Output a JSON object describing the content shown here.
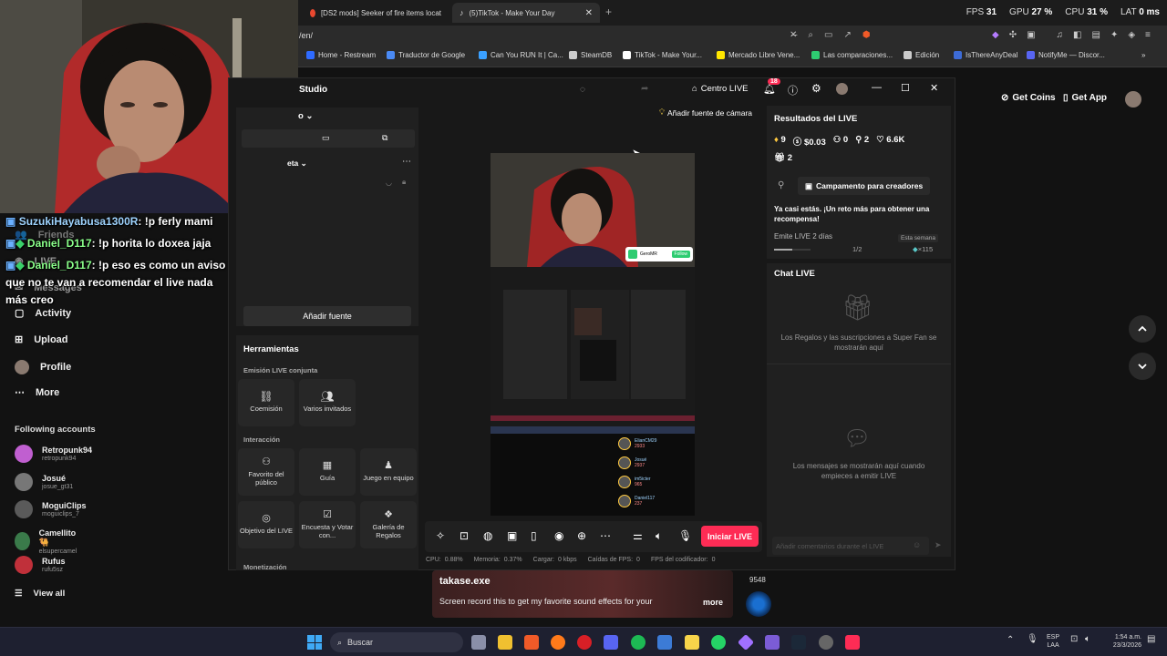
{
  "browser": {
    "tabs": [
      {
        "label": "[DS2 mods] Seeker of fire items locat",
        "active": false
      },
      {
        "label": "(5)TikTok - Make Your Day",
        "active": true
      }
    ],
    "url": "/en/",
    "perf": {
      "fps_label": "FPS",
      "fps": "31",
      "gpu_label": "GPU",
      "gpu": "27 %",
      "cpu_label": "CPU",
      "cpu": "31 %",
      "lat_label": "LAT",
      "lat": "0 ms"
    },
    "bookmarks": [
      {
        "label": "Home - Restream",
        "color": "#2f6bff"
      },
      {
        "label": "Traductor de Google",
        "color": "#4a8af4"
      },
      {
        "label": "Can You RUN It | Ca...",
        "color": "#3aa0ff"
      },
      {
        "label": "SteamDB",
        "color": "#cccccc"
      },
      {
        "label": "TikTok - Make Your...",
        "color": "#ffffff"
      },
      {
        "label": "Mercado Libre Vene...",
        "color": "#ffe600"
      },
      {
        "label": "Las comparaciones...",
        "color": "#2ecc71"
      },
      {
        "label": "Edición",
        "color": "#cccccc"
      },
      {
        "label": "IsThereAnyDeal",
        "color": "#3d6bd6"
      },
      {
        "label": "NotifyMe — Discor...",
        "color": "#5865f2"
      }
    ]
  },
  "chat_overlay": [
    {
      "user": "SuzukiHayabusa1300R",
      "msg": ": !p ferly mami"
    },
    {
      "user": "Daniel_D117",
      "msg": ": !p horita lo doxea jaja"
    },
    {
      "user": "Daniel_D117",
      "msg": ": !p eso es como un aviso que no te van a recomendar el live nada más creo"
    }
  ],
  "sidebar": {
    "items": [
      {
        "label": "Friends"
      },
      {
        "label": "LIVE"
      },
      {
        "label": "Messages"
      },
      {
        "label": "Activity"
      },
      {
        "label": "Upload"
      },
      {
        "label": "Profile"
      },
      {
        "label": "More"
      }
    ],
    "following_title": "Following accounts",
    "accounts": [
      {
        "name": "Retropunk94",
        "handle": "retropunk94",
        "color": "#c05fd0"
      },
      {
        "name": "Josué",
        "handle": "josue_gt31",
        "color": "#777777"
      },
      {
        "name": "MoguiClips",
        "handle": "moguiclips_7",
        "color": "#5a5a5a"
      },
      {
        "name": "Camellito 🐫",
        "handle": "elsupercamel",
        "color": "#3a7a4a"
      },
      {
        "name": "Rufus",
        "handle": "rufu5sz",
        "color": "#c0303a"
      }
    ],
    "view_all": "View all"
  },
  "header_right": {
    "get_coins": "Get Coins",
    "get_app": "Get App"
  },
  "studio": {
    "title": "Studio",
    "scene_dropdown": "o",
    "folder_dropdown": "eta",
    "centro_live": "Centro LIVE",
    "notif_count": "18",
    "camera_hint": "Añadir fuente de cámara",
    "add_source": "Añadir fuente",
    "tools_title": "Herramientas",
    "joint_title": "Emisión LIVE conjunta",
    "joint_tools": [
      "Coemisión",
      "Varios invitados"
    ],
    "interaction_title": "Interacción",
    "interaction_tools": [
      "Favorito del público",
      "Guía",
      "Juego en equipo",
      "Objetivo del LIVE",
      "Encuesta y Votar con...",
      "Galería de Regalos"
    ],
    "monetization_title": "Monetización",
    "go_live": "Iniciar LIVE",
    "stats": [
      {
        "label": "CPU:",
        "value": "0.88%"
      },
      {
        "label": "Memoria:",
        "value": "0.37%"
      },
      {
        "label": "Cargar:",
        "value": "0 kbps"
      },
      {
        "label": "Caídas de FPS:",
        "value": "0"
      },
      {
        "label": "FPS del codificador:",
        "value": "0"
      }
    ],
    "results": {
      "title": "Resultados del LIVE",
      "diamonds": "9",
      "money": "$0.03",
      "viewers": "0",
      "followers": "2",
      "likes": "6.6K",
      "gifts": "2",
      "campaign": "Campamento para creadores",
      "challenge": "Ya casi estás. ¡Un reto más para obtener una recompensa!",
      "task": "Emite LIVE 2 días",
      "task_period": "Esta semana",
      "task_progress_text": "1/2",
      "task_progress": 0.5,
      "task_reward": "×115"
    },
    "chat": {
      "title": "Chat LIVE",
      "gifts_empty": "Los Regalos y las suscripciones a Super Fan se mostrarán aquí",
      "msgs_empty": "Los mensajes se mostrarán aquí cuando empieces a emitir LIVE",
      "placeholder": "Añadir comentarios durante el LIVE"
    },
    "preview": {
      "follow_name": "GeroMR",
      "follow_btn": "Follow",
      "viewers": [
        {
          "name": "ElianCM29",
          "count": "2933"
        },
        {
          "name": "Josué",
          "count": "2937"
        },
        {
          "name": "im5icter",
          "count": "965"
        },
        {
          "name": "Daniel117",
          "count": "237"
        }
      ]
    }
  },
  "video_caption": {
    "author": "takase.exe",
    "text": "Screen record this to get my favorite sound effects for your",
    "more": "more",
    "count": "9548"
  },
  "taskbar": {
    "search": "Buscar",
    "lang_top": "ESP",
    "lang_bottom": "LAA",
    "time": "1:54 a.m.",
    "date": "23/3/2026"
  }
}
